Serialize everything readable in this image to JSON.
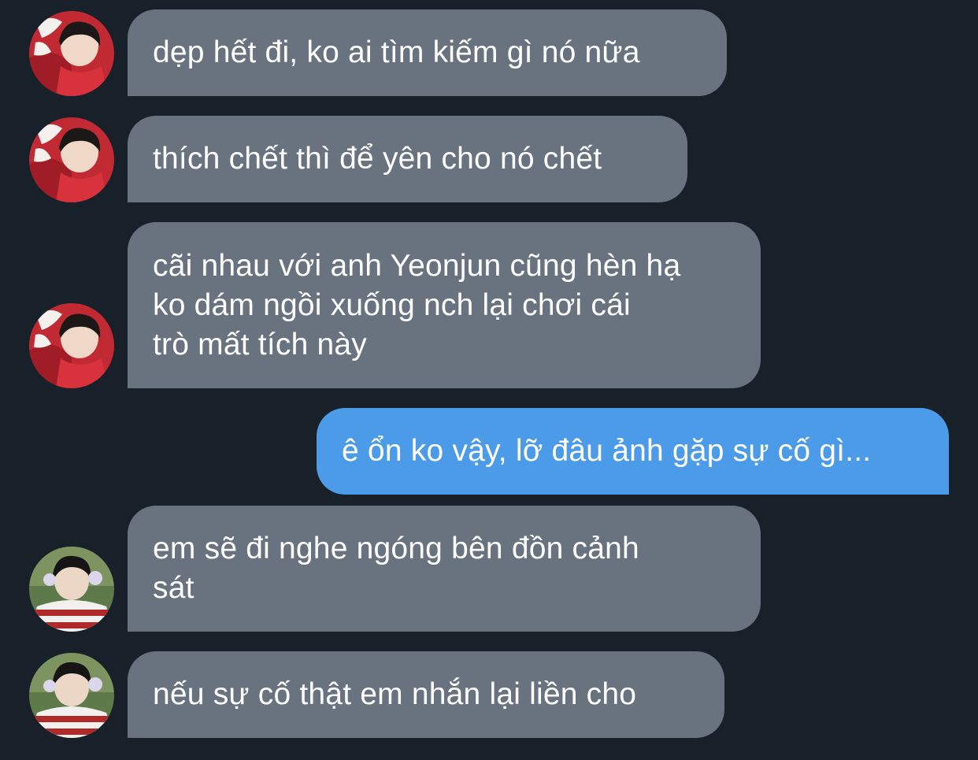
{
  "messages": [
    {
      "direction": "incoming",
      "sender_avatar": "avatar-red-outfit",
      "text": "dẹp hết đi, ko ai tìm kiếm gì nó nữa"
    },
    {
      "direction": "incoming",
      "sender_avatar": "avatar-red-outfit",
      "text": "thích chết thì để yên cho nó chết"
    },
    {
      "direction": "incoming",
      "sender_avatar": "avatar-red-outfit",
      "text": "cãi nhau với anh Yeonjun cũng hèn hạ\nko dám ngồi xuống nch lại chơi cái\ntrò mất tích này"
    },
    {
      "direction": "outgoing",
      "text": "ê ổn ko vậy, lỡ đâu ảnh gặp sự cố gì..."
    },
    {
      "direction": "incoming",
      "sender_avatar": "avatar-striped-sweater",
      "text": "em sẽ đi nghe ngóng bên đồn cảnh\nsát"
    },
    {
      "direction": "incoming",
      "sender_avatar": "avatar-striped-sweater",
      "text": "nếu sự cố thật em nhắn lại liền cho"
    }
  ],
  "colors": {
    "background": "#18202a",
    "incoming_bubble": "#68737f",
    "outgoing_bubble": "#4b9be8",
    "text": "#ffffff"
  }
}
